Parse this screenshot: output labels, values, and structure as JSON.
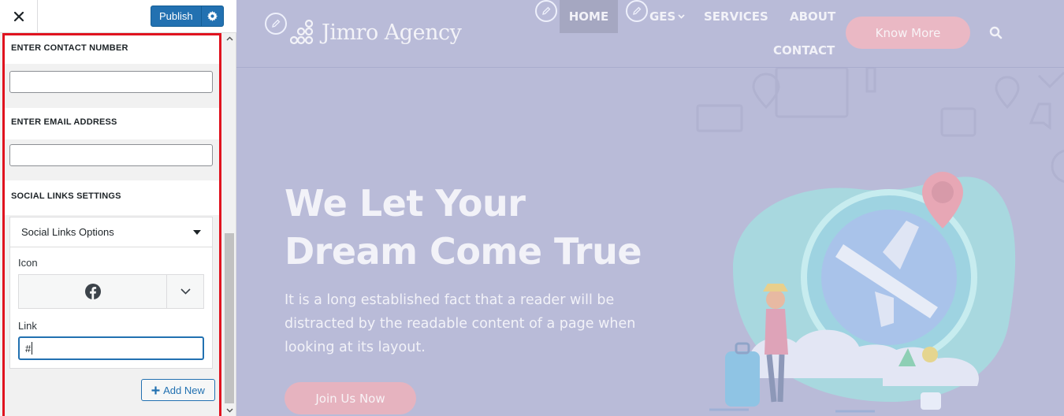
{
  "customizer": {
    "close_icon": "close-icon",
    "publish_label": "Publish",
    "settings_icon": "gear-icon",
    "contact_number_title": "ENTER CONTACT NUMBER",
    "contact_number_value": "",
    "email_title": "ENTER EMAIL ADDRESS",
    "email_value": "",
    "social_title": "SOCIAL LINKS SETTINGS",
    "social_accordion_label": "Social Links Options",
    "icon_label": "Icon",
    "icon_selected": "facebook-icon",
    "link_label": "Link",
    "link_value": "#",
    "add_new_label": "Add New",
    "accent_color": "#2271b1",
    "highlight_color": "#e0131f"
  },
  "site": {
    "logo_text": "Jimro Agency",
    "nav": {
      "home": "HOME",
      "pages": "GES",
      "services": "SERVICES",
      "about": "ABOUT",
      "contact": "CONTACT"
    },
    "cta_label": "Know More",
    "hero_title_line1": "We Let Your",
    "hero_title_line2": "Dream Come True",
    "hero_text": "It is a long established fact that a reader will be distracted by the readable content of a page when looking at its layout.",
    "join_label": "Join Us Now",
    "overlay_color": "#b9bbd8"
  }
}
